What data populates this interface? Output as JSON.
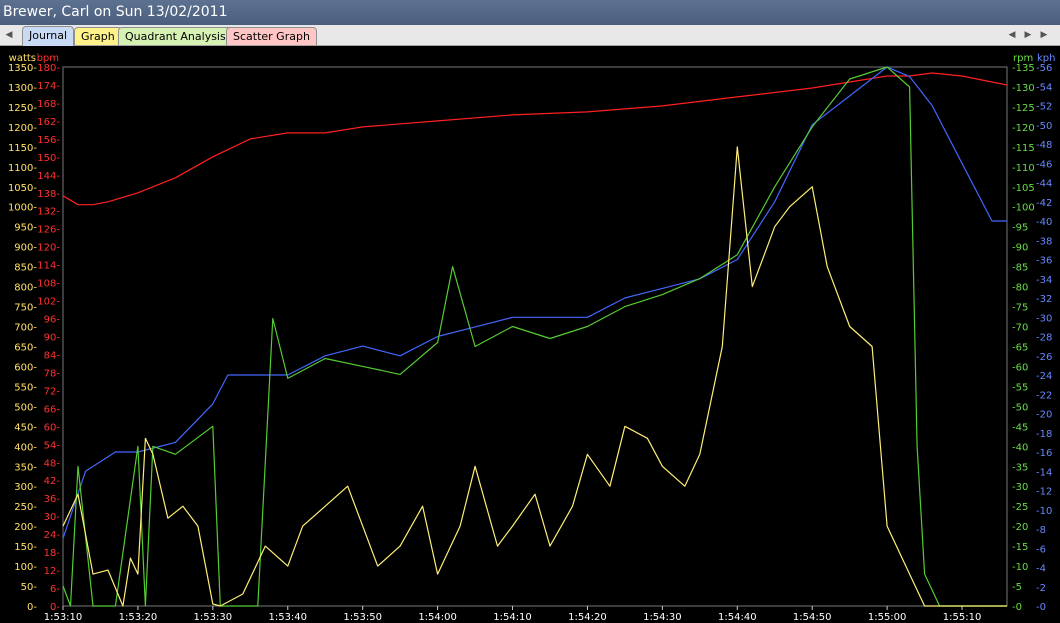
{
  "window": {
    "title": "Brewer, Carl on Sun 13/02/2011"
  },
  "tabs": [
    {
      "label": "Journal",
      "color": "#c9daf5",
      "active": true
    },
    {
      "label": "Graph",
      "color": "#fff28a",
      "active": false
    },
    {
      "label": "Quadrant Analysis",
      "color": "#d6f2b3",
      "active": false
    },
    {
      "label": "Scatter Graph",
      "color": "#ffc6c6",
      "active": false
    }
  ],
  "chart_data": {
    "type": "line",
    "background": "#000000",
    "grid": false,
    "x": {
      "min": "1:53:10",
      "max": "1:55:16",
      "ticks": [
        "1:53:10",
        "1:53:20",
        "1:53:30",
        "1:53:40",
        "1:53:50",
        "1:54:00",
        "1:54:10",
        "1:54:20",
        "1:54:30",
        "1:54:40",
        "1:54:50",
        "1:55:00",
        "1:55:10"
      ]
    },
    "axes": [
      {
        "id": "watts",
        "label": "watts",
        "color": "#ffe066",
        "side": "left",
        "min": 0,
        "max": 1350,
        "step": 50
      },
      {
        "id": "bpm",
        "label": "bpm",
        "color": "#ff3030",
        "side": "left",
        "min": 0,
        "max": 180,
        "step": 6
      },
      {
        "id": "rpm",
        "label": "rpm",
        "color": "#66dd44",
        "side": "right",
        "min": 0,
        "max": 135,
        "step": 5
      },
      {
        "id": "kph",
        "label": "kph",
        "color": "#6688ff",
        "side": "right",
        "min": 0,
        "max": 56,
        "step": 2
      }
    ],
    "series": [
      {
        "axis": "bpm",
        "color": "#ff2020",
        "x": [
          "1:53:10",
          "1:53:12",
          "1:53:14",
          "1:53:16",
          "1:53:20",
          "1:53:25",
          "1:53:30",
          "1:53:35",
          "1:53:40",
          "1:53:45",
          "1:53:50",
          "1:54:00",
          "1:54:10",
          "1:54:20",
          "1:54:30",
          "1:54:40",
          "1:54:50",
          "1:54:55",
          "1:55:00",
          "1:55:03",
          "1:55:06",
          "1:55:10",
          "1:55:14",
          "1:55:16"
        ],
        "values": [
          137,
          134,
          134,
          135,
          138,
          143,
          150,
          156,
          158,
          158,
          160,
          162,
          164,
          165,
          167,
          170,
          173,
          175,
          177,
          177,
          178,
          177,
          175,
          174
        ]
      },
      {
        "axis": "kph",
        "color": "#4466ff",
        "x": [
          "1:53:10",
          "1:53:13",
          "1:53:17",
          "1:53:20",
          "1:53:25",
          "1:53:30",
          "1:53:32",
          "1:53:35",
          "1:53:40",
          "1:53:45",
          "1:53:50",
          "1:53:55",
          "1:54:00",
          "1:54:05",
          "1:54:10",
          "1:54:15",
          "1:54:20",
          "1:54:25",
          "1:54:30",
          "1:54:35",
          "1:54:40",
          "1:54:45",
          "1:54:50",
          "1:54:55",
          "1:55:00",
          "1:55:03",
          "1:55:06",
          "1:55:10",
          "1:55:14",
          "1:55:16"
        ],
        "values": [
          7,
          14,
          16,
          16,
          17,
          21,
          24,
          24,
          24,
          26,
          27,
          26,
          28,
          29,
          30,
          30,
          30,
          32,
          33,
          34,
          36,
          42,
          50,
          53,
          56,
          55,
          52,
          46,
          40,
          40
        ]
      },
      {
        "axis": "rpm",
        "color": "#55cc33",
        "x": [
          "1:53:10",
          "1:53:11",
          "1:53:12",
          "1:53:14",
          "1:53:17",
          "1:53:20",
          "1:53:21",
          "1:53:22",
          "1:53:25",
          "1:53:30",
          "1:53:31",
          "1:53:35",
          "1:53:36",
          "1:53:38",
          "1:53:40",
          "1:53:45",
          "1:53:50",
          "1:53:55",
          "1:54:00",
          "1:54:02",
          "1:54:05",
          "1:54:10",
          "1:54:15",
          "1:54:20",
          "1:54:25",
          "1:54:30",
          "1:54:35",
          "1:54:40",
          "1:54:45",
          "1:54:50",
          "1:54:55",
          "1:55:00",
          "1:55:03",
          "1:55:04",
          "1:55:05",
          "1:55:07",
          "1:55:16"
        ],
        "values": [
          5,
          0,
          35,
          0,
          0,
          40,
          0,
          40,
          38,
          45,
          0,
          0,
          0,
          72,
          57,
          62,
          60,
          58,
          66,
          85,
          65,
          70,
          67,
          70,
          75,
          78,
          82,
          88,
          105,
          120,
          132,
          135,
          130,
          40,
          8,
          0,
          0
        ]
      },
      {
        "axis": "watts",
        "color": "#ffee77",
        "x": [
          "1:53:10",
          "1:53:12",
          "1:53:14",
          "1:53:16",
          "1:53:18",
          "1:53:19",
          "1:53:20",
          "1:53:21",
          "1:53:22",
          "1:53:24",
          "1:53:26",
          "1:53:28",
          "1:53:30",
          "1:53:31",
          "1:53:34",
          "1:53:37",
          "1:53:40",
          "1:53:42",
          "1:53:45",
          "1:53:48",
          "1:53:50",
          "1:53:52",
          "1:53:55",
          "1:53:58",
          "1:54:00",
          "1:54:03",
          "1:54:05",
          "1:54:08",
          "1:54:10",
          "1:54:13",
          "1:54:15",
          "1:54:18",
          "1:54:20",
          "1:54:23",
          "1:54:25",
          "1:54:28",
          "1:54:30",
          "1:54:33",
          "1:54:35",
          "1:54:38",
          "1:54:40",
          "1:54:42",
          "1:54:44",
          "1:54:45",
          "1:54:47",
          "1:54:50",
          "1:54:52",
          "1:54:55",
          "1:54:58",
          "1:55:00",
          "1:55:03",
          "1:55:05",
          "1:55:07",
          "1:55:10",
          "1:55:16"
        ],
        "values": [
          200,
          280,
          80,
          90,
          0,
          120,
          80,
          420,
          380,
          220,
          250,
          200,
          5,
          0,
          30,
          150,
          100,
          200,
          250,
          300,
          200,
          100,
          150,
          250,
          80,
          200,
          350,
          150,
          200,
          280,
          150,
          250,
          380,
          300,
          450,
          420,
          350,
          300,
          380,
          650,
          1150,
          800,
          900,
          950,
          1000,
          1050,
          850,
          700,
          650,
          200,
          80,
          0,
          0,
          0,
          0
        ]
      }
    ]
  }
}
